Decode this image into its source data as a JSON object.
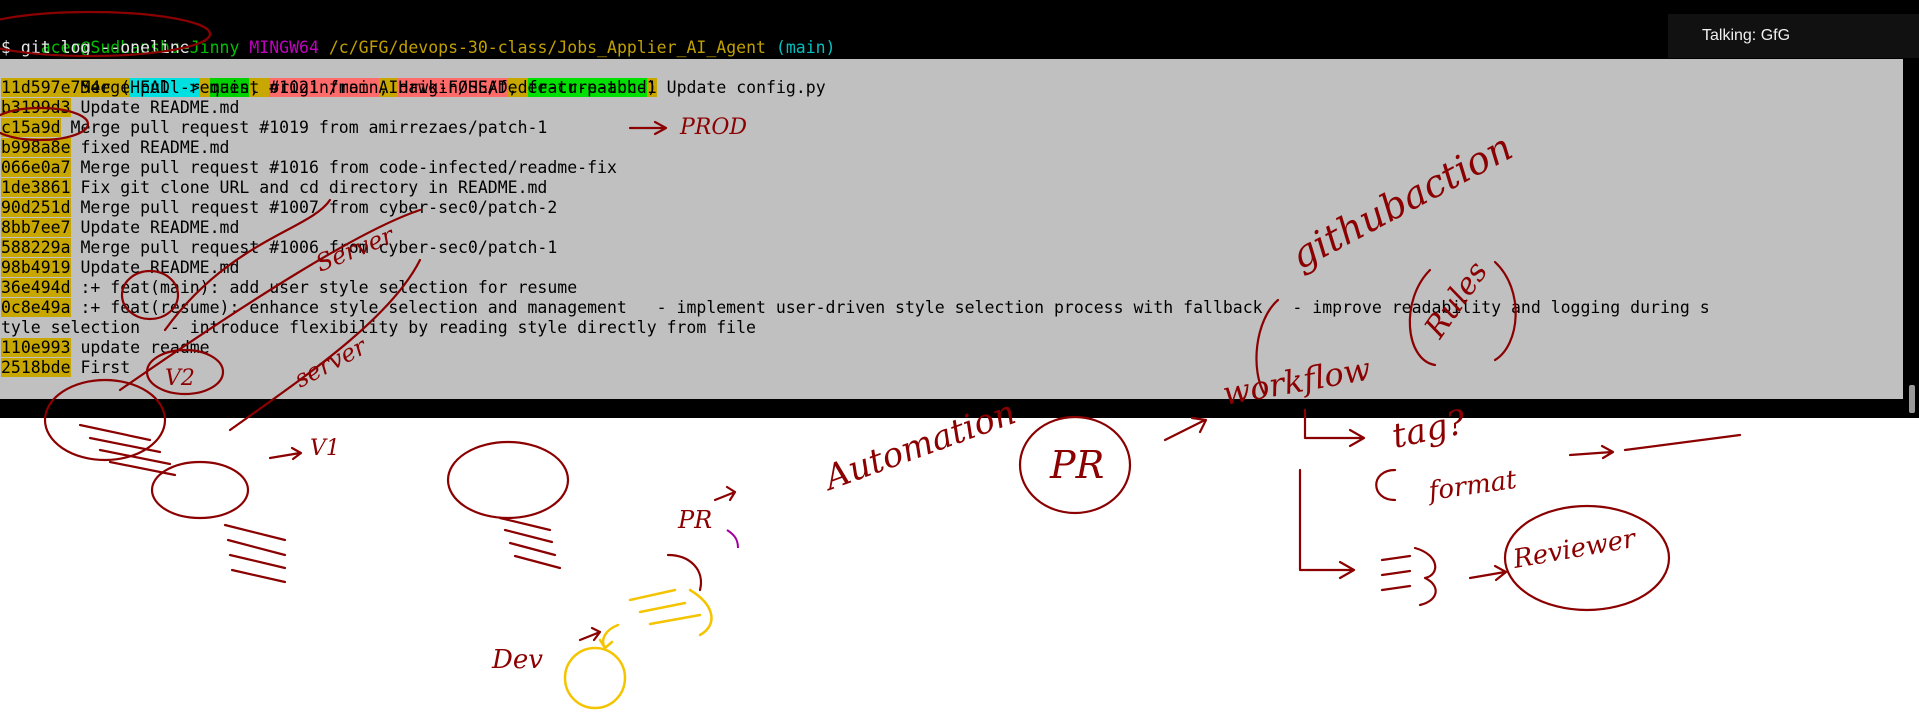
{
  "terminal": {
    "prompt": {
      "user_host": "acer@Sudhanshu-Jinny",
      "shell": "MINGW64",
      "path": "/c/GFG/devops-30-class/Jobs_Applier_AI_Agent",
      "branch": "(main)"
    },
    "command": "$ git log --oneline",
    "head_commit": {
      "hash": "8bb754e",
      "refs_open": "(",
      "head_ref": "HEAD ->",
      "main_ref": "main",
      "origin_main_ref": "origin/main",
      "origin_head_ref": "origin/HEAD",
      "feature_ref": "feature-abcd",
      "refs_close": ")",
      "message": " Update config.py"
    },
    "commits": [
      {
        "hash": "11d597e",
        "message": " Merge pull request #1021 from AIHawk-FOSS/feder-cr-patch-1"
      },
      {
        "hash": "b3199d3",
        "message": " Update README.md"
      },
      {
        "hash": "c15a9d",
        "message": " Merge pull request #1019 from amirrezaes/patch-1"
      },
      {
        "hash": "b998a8e",
        "message": " fixed README.md"
      },
      {
        "hash": "066e0a7",
        "message": " Merge pull request #1016 from code-infected/readme-fix"
      },
      {
        "hash": "1de3861",
        "message": " Fix git clone URL and cd directory in README.md"
      },
      {
        "hash": "90d251d",
        "message": " Merge pull request #1007 from cyber-sec0/patch-2"
      },
      {
        "hash": "8bb7ee7",
        "message": " Update README.md"
      },
      {
        "hash": "588229a",
        "message": " Merge pull request #1006 from cyber-sec0/patch-1"
      },
      {
        "hash": "98b4919",
        "message": " Update README.md"
      },
      {
        "hash": "36e494d",
        "message": " :+ feat(main): add user style selection for resume"
      },
      {
        "hash": "0c8e49a",
        "message": " :+ feat(resume): enhance style selection and management   - implement user-driven style selection process with fallback   - improve readability and logging during s"
      }
    ],
    "wrapped_line": "tyle selection   - introduce flexibility by reading style directly from file",
    "tail_commits": [
      {
        "hash": "110e993",
        "message": " update readme"
      },
      {
        "hash": "2518bde",
        "message": " First"
      }
    ]
  },
  "notification": {
    "text": "Talking: GfG"
  },
  "annotations": {
    "prod": "PROD",
    "v2": "V2",
    "v1": "V1",
    "server1": "Server",
    "server2": "server",
    "pr_small": "PR",
    "dev": "Dev",
    "automation": "Automation",
    "pr_big": "PR",
    "workflow": "workflow",
    "github_action": "githubaction",
    "rules": "Rules",
    "tag": "tag?",
    "format": "format",
    "reviewer": "Reviewer",
    "ink_color": "#8b0000",
    "highlight_color": "#f5c400"
  }
}
